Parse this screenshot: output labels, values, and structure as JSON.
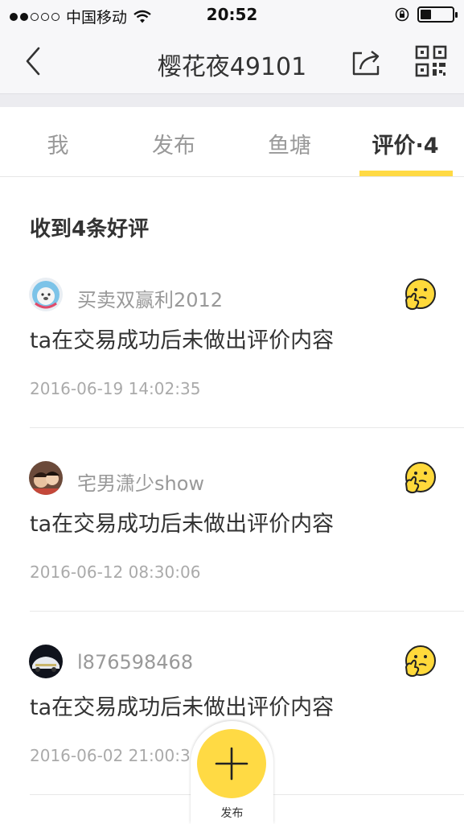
{
  "status_bar": {
    "carrier": "中国移动",
    "time": "20:52",
    "battery_level": 0.35
  },
  "nav": {
    "title": "樱花夜49101"
  },
  "tabs": [
    {
      "label": "我"
    },
    {
      "label": "发布"
    },
    {
      "label": "鱼塘"
    },
    {
      "label": "评价·4"
    }
  ],
  "section_title": "收到4条好评",
  "reviews": [
    {
      "username": "买卖双赢利2012",
      "text": "ta在交易成功后未做出评价内容",
      "time": "2016-06-19 14:02:35"
    },
    {
      "username": "宅男潇少show",
      "text": "ta在交易成功后未做出评价内容",
      "time": "2016-06-12 08:30:06"
    },
    {
      "username": "l876598468",
      "text": "ta在交易成功后未做出评价内容",
      "time": "2016-06-02 21:00:3"
    }
  ],
  "fab": {
    "label": "发布"
  },
  "colors": {
    "accent": "#ffda44",
    "muted": "#999999",
    "text": "#333333"
  }
}
